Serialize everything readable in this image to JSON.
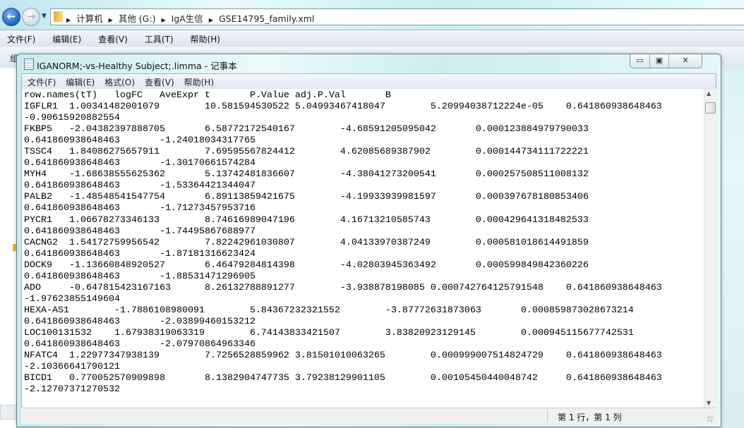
{
  "explorer": {
    "breadcrumb": [
      "计算机",
      "其他 (G:)",
      "IgA生信",
      "GSE14795_family.xml"
    ],
    "menu": [
      "文件(F)",
      "编辑(E)",
      "查看(V)",
      "工具(T)",
      "帮助(H)"
    ],
    "toolbar_partial": "组"
  },
  "notepad": {
    "title": "IGANORM;-vs-Healthy Subject;.limma - 记事本",
    "caption_buttons": {
      "minimize": "▭",
      "maximize": "▣",
      "close": "✕"
    },
    "menu": [
      "文件(F)",
      "编辑(E)",
      "格式(O)",
      "查看(V)",
      "帮助(H)"
    ],
    "header": [
      "row.names(tT)",
      "logFC",
      "AveExpr",
      "t",
      "P.Value",
      "adj.P.Val",
      "B"
    ],
    "rows": [
      [
        "IGFLR1",
        "1.00341482001079",
        "10.581594530522",
        "5.04993467418047",
        "5.20994038712224e-05",
        "0.641860938648463",
        "-0.90615920882554"
      ],
      [
        "FKBP5",
        "-2.04382397888705",
        "6.58772172540167",
        "-4.68591205095042",
        "0.000123884979790033",
        "0.641860938648463",
        "-1.24018034317765"
      ],
      [
        "TSSC4",
        "1.84086275657911",
        "7.69595567824412",
        "4.62085689387902",
        "0.000144734111722221",
        "0.641860938648463",
        "-1.30170661574284"
      ],
      [
        "MYH4",
        "-1.68638555625362",
        "5.13742481836607",
        "-4.38041273200541",
        "0.000257508511008132",
        "0.641860938648463",
        "-1.53364421344047"
      ],
      [
        "PALB2",
        "-1.48548541547754",
        "6.89113859421675",
        "-4.19933939981597",
        "0.000397678180853406",
        "0.641860938648463",
        "-1.71273457953716"
      ],
      [
        "PYCR1",
        "1.06678273346133",
        "8.74616989047196",
        "4.16713210585743",
        "0.000429641318482533",
        "0.641860938648463",
        "-1.74495867688977"
      ],
      [
        "CACNG2",
        "1.54172759956542",
        "7.82242961030807",
        "4.04133970387249",
        "0.000581018614491859",
        "0.641860938648463",
        "-1.87181316623424"
      ],
      [
        "DOCK9",
        "-1.13660848920527",
        "6.46479284814398",
        "-4.02803945363492",
        "0.000599849842360226",
        "0.641860938648463",
        "-1.88531471296905"
      ],
      [
        "ADO",
        "-0.647815423167163",
        "8.26132788891277",
        "-3.938878198085",
        "0.000742764125791548",
        "0.641860938648463",
        "-1.97623855149604"
      ],
      [
        "HEXA-AS1",
        "-1.7886108980091",
        "5.84367232321552",
        "-3.87772631873063",
        "0.000859873028673214",
        "0.641860938648463",
        "-2.03899460153212"
      ],
      [
        "LOC100131532",
        "1.67938319063319",
        "6.74143833421507",
        "3.83820923129145",
        "0.000945115677742531",
        "0.641860938648463",
        "-2.07970864963346"
      ],
      [
        "NFATC4",
        "1.22977347938139",
        "7.7256528859962",
        "3.81501010063265",
        "0.000999007514824729",
        "0.641860938648463",
        "-2.10366641790121"
      ],
      [
        "BICD1",
        "0.770052570909898",
        "8.1382904747735",
        "3.79238129901105",
        "0.00105450440048742",
        "0.641860938648463",
        "-2.12707371270532"
      ]
    ],
    "status_position": "第 1 行，第 1 列"
  }
}
